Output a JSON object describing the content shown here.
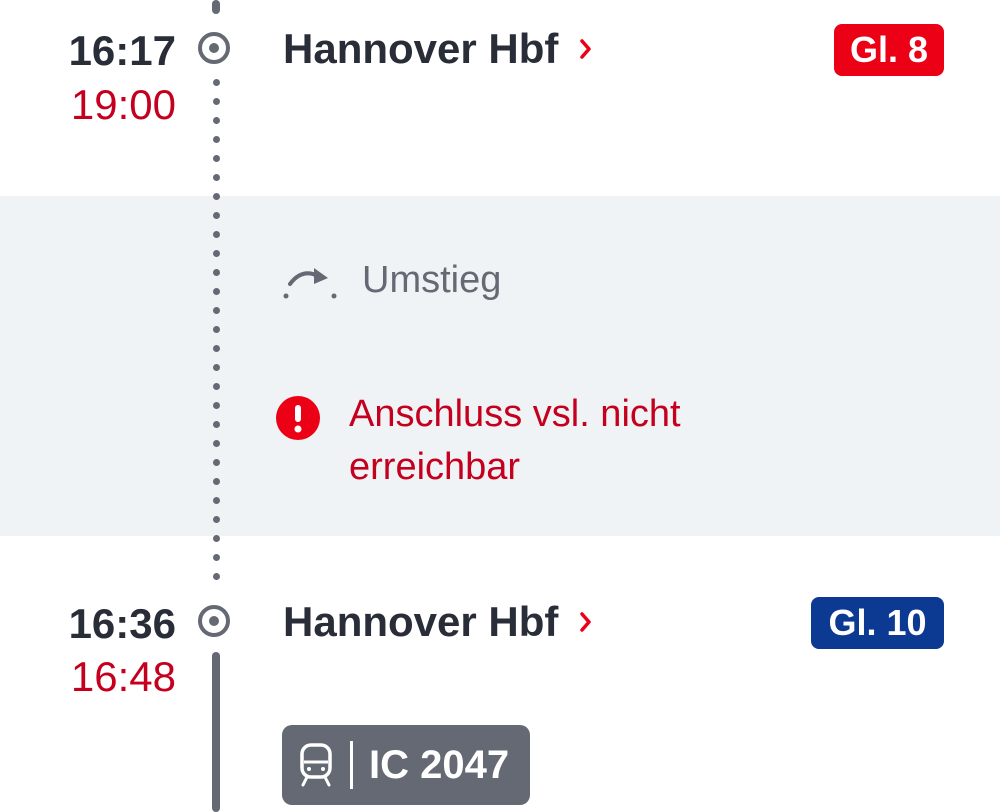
{
  "stops": [
    {
      "time_scheduled": "16:17",
      "time_actual": "19:00",
      "station": "Hannover Hbf",
      "platform": "Gl. 8",
      "platform_changed": true
    },
    {
      "time_scheduled": "16:36",
      "time_actual": "16:48",
      "station": "Hannover Hbf",
      "platform": "Gl. 10",
      "platform_changed": false
    }
  ],
  "transfer": {
    "label": "Umstieg",
    "warning_line1": "Anschluss vsl. nicht",
    "warning_line2": "erreichbar",
    "icon": "transfer-arrow-icon",
    "warning_icon": "exclamation-circle-icon"
  },
  "train": {
    "name": "IC 2047",
    "icon": "train-icon"
  },
  "colors": {
    "delay_red": "#c5001f",
    "platform_changed": "#ec0016",
    "platform_normal": "#0c3992",
    "timeline_gray": "#646973",
    "transfer_background": "#f0f3f5"
  }
}
